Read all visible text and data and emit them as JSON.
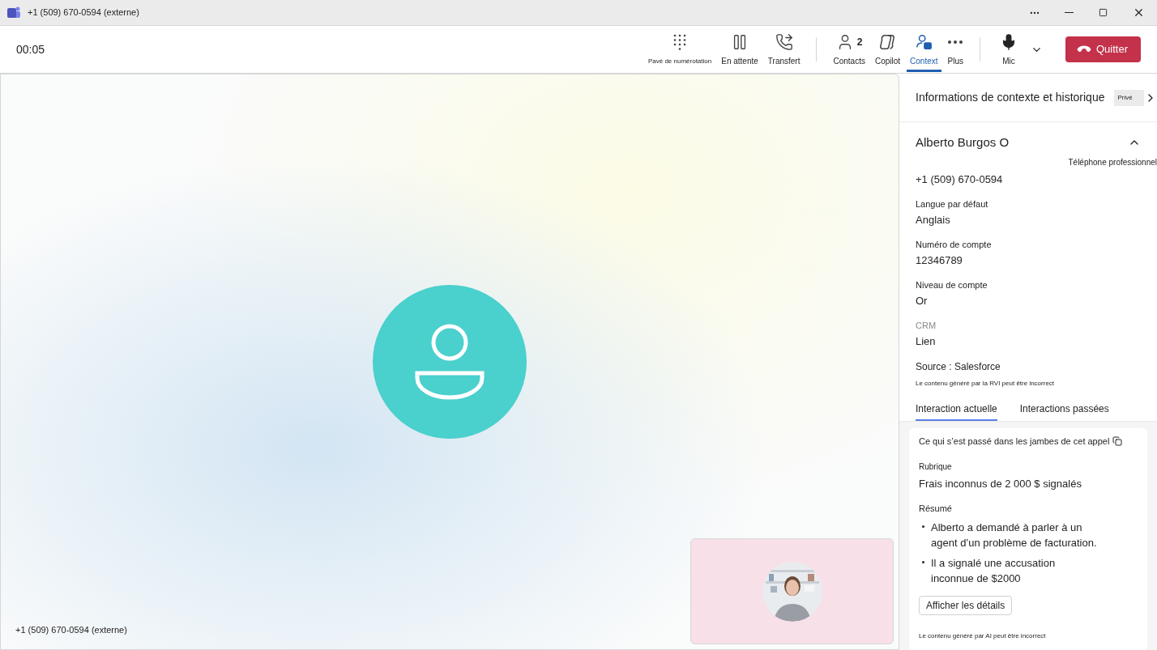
{
  "title_bar": {
    "title": "+1 (509) 670-0594 (externe)"
  },
  "call": {
    "timer": "00:05"
  },
  "toolbar": {
    "groups": [
      [
        {
          "kind": "dialpad",
          "label": "Pavé de numérotation",
          "selected": false
        },
        {
          "kind": "hold",
          "label": "En attente",
          "selected": false
        },
        {
          "kind": "transfer",
          "label": "Transfert",
          "selected": false
        }
      ],
      [
        {
          "kind": "contacts",
          "label": "Contacts",
          "count": "2",
          "selected": false
        },
        {
          "kind": "copilot",
          "label": "Copilot",
          "selected": false
        },
        {
          "kind": "context",
          "label": "Context",
          "selected": true
        },
        {
          "kind": "more",
          "label": "Plus",
          "selected": false
        }
      ]
    ],
    "mic": {
      "label": "Mic"
    },
    "end_button": {
      "label": "Quitter"
    }
  },
  "stage": {
    "caller_label": "+1 (509) 670-0594 (externe)"
  },
  "side_panel": {
    "title": "Informations de contexte et historique",
    "badge": "Privé",
    "contact": {
      "name": "Alberto Burgos O",
      "expanded": true,
      "phone_type": "Téléphone professionnel",
      "phone": "+1 (509) 670-0594"
    },
    "fields": [
      {
        "kind": "normal",
        "label": "Langue par défaut",
        "value": "Anglais"
      },
      {
        "kind": "normal",
        "label": "Numéro de compte",
        "value": "12346789"
      },
      {
        "kind": "normal",
        "label": "Niveau de compte",
        "value": "Or"
      },
      {
        "kind": "muted",
        "label": "CRM",
        "value": "Lien"
      }
    ],
    "source": "Source : Salesforce",
    "disclaimer": "Le contenu généré par la RVI peut être incorrect",
    "tabs": [
      {
        "label": "Interaction actuelle",
        "selected": true
      },
      {
        "label": "Interactions passées",
        "selected": false
      }
    ],
    "summary": {
      "heading": "Ce qui s’est passé dans les jambes de cet appel",
      "topic_label": "Rubrique",
      "topic": "Frais inconnus de 2 000 $ signalés",
      "summary_label": "Résumé",
      "bullets": [
        "Alberto a demandé à parler à un agent d’un problème de facturation.",
        "Il a signalé une accusation inconnue de $2000"
      ],
      "details_button": "Afficher les détails",
      "disclaimer": "Le contenu généré par AI peut être incorrect"
    }
  }
}
